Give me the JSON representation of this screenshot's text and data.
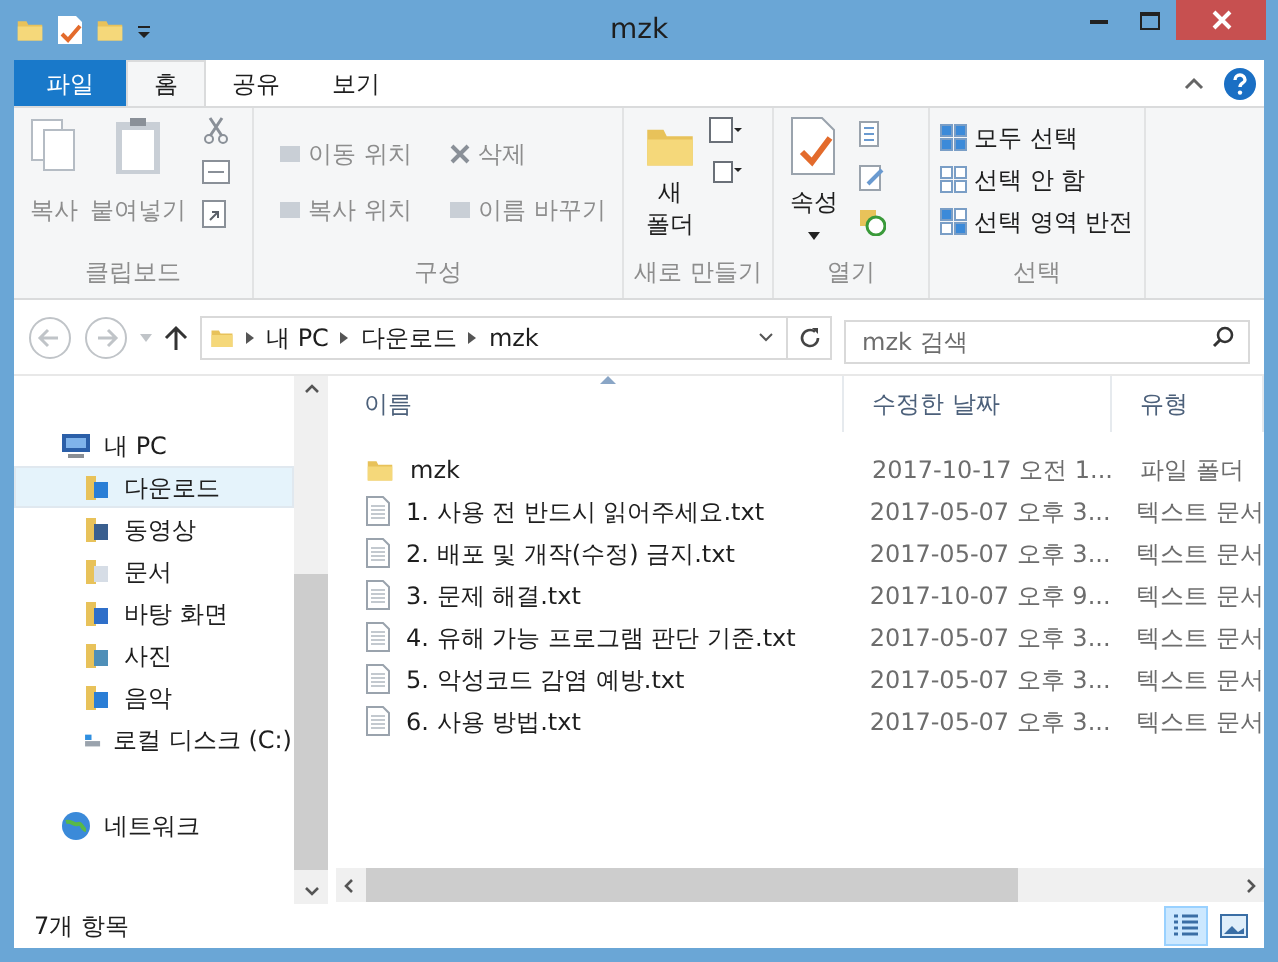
{
  "window": {
    "title": "mzk"
  },
  "tabs": [
    {
      "label": "파일",
      "kind": "file",
      "selected": false
    },
    {
      "label": "홈",
      "kind": "tab",
      "selected": true
    },
    {
      "label": "공유",
      "kind": "tab",
      "selected": false
    },
    {
      "label": "보기",
      "kind": "tab",
      "selected": false
    }
  ],
  "ribbon": {
    "clipboard": {
      "label": "클립보드",
      "copy": {
        "label": "복사",
        "disabled": true
      },
      "paste": {
        "label": "붙여넣기",
        "disabled": true
      }
    },
    "organize": {
      "label": "구성",
      "items": [
        {
          "label": "이동 위치",
          "disabled": true
        },
        {
          "label": "삭제",
          "disabled": true
        },
        {
          "label": "복사 위치",
          "disabled": true
        },
        {
          "label": "이름 바꾸기",
          "disabled": true
        }
      ]
    },
    "new": {
      "label": "새로 만들기",
      "new_folder": [
        "새",
        "폴더"
      ]
    },
    "open": {
      "label": "열기",
      "properties": "속성"
    },
    "select": {
      "label": "선택",
      "items": [
        {
          "label": "모두 선택",
          "disabled": false
        },
        {
          "label": "선택 안 함",
          "disabled": false
        },
        {
          "label": "선택 영역 반전",
          "disabled": false
        }
      ]
    }
  },
  "address": {
    "path": [
      "내 PC",
      "다운로드",
      "mzk"
    ]
  },
  "search": {
    "placeholder": "mzk 검색"
  },
  "nav": [
    {
      "label": "내 PC",
      "kind": "pc",
      "selected": false,
      "children": [
        {
          "label": "다운로드",
          "kind": "download",
          "selected": true
        },
        {
          "label": "동영상",
          "kind": "video",
          "selected": false
        },
        {
          "label": "문서",
          "kind": "docs",
          "selected": false
        },
        {
          "label": "바탕 화면",
          "kind": "desktop",
          "selected": false
        },
        {
          "label": "사진",
          "kind": "pictures",
          "selected": false
        },
        {
          "label": "음악",
          "kind": "music",
          "selected": false
        },
        {
          "label": "로컬 디스크 (C:)",
          "kind": "disk",
          "selected": false
        }
      ]
    },
    {
      "label": "네트워크",
      "kind": "network",
      "selected": false
    }
  ],
  "table": {
    "columns": [
      "이름",
      "수정한 날짜",
      "유형"
    ],
    "rows": [
      {
        "kind": "folder",
        "name": "mzk",
        "date": "2017-10-17 오전 1...",
        "type": "파일 폴더"
      },
      {
        "kind": "text",
        "name": "1. 사용 전 반드시 읽어주세요.txt",
        "date": "2017-05-07 오후 3...",
        "type": "텍스트 문서"
      },
      {
        "kind": "text",
        "name": "2. 배포 및 개작(수정) 금지.txt",
        "date": "2017-05-07 오후 3...",
        "type": "텍스트 문서"
      },
      {
        "kind": "text",
        "name": "3. 문제 해결.txt",
        "date": "2017-10-07 오후 9...",
        "type": "텍스트 문서"
      },
      {
        "kind": "text",
        "name": "4. 유해 가능 프로그램 판단 기준.txt",
        "date": "2017-05-07 오후 3...",
        "type": "텍스트 문서"
      },
      {
        "kind": "text",
        "name": "5. 악성코드 감염 예방.txt",
        "date": "2017-05-07 오후 3...",
        "type": "텍스트 문서"
      },
      {
        "kind": "text",
        "name": "6. 사용 방법.txt",
        "date": "2017-05-07 오후 3...",
        "type": "텍스트 문서"
      }
    ]
  },
  "status_bar": {
    "count": "7개 항목",
    "views": [
      {
        "kind": "details",
        "selected": true
      },
      {
        "kind": "tiles",
        "selected": false
      }
    ]
  }
}
